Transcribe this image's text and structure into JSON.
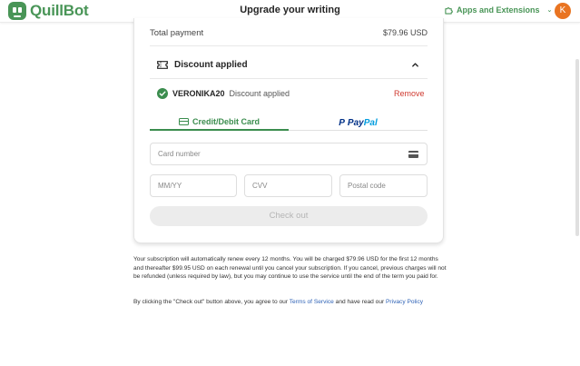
{
  "header": {
    "brand": "QuillBot",
    "title": "Upgrade your writing",
    "apps_label": "Apps and Extensions",
    "avatar_initial": "K"
  },
  "checkout": {
    "total_label": "Total payment",
    "total_value": "$79.96 USD",
    "discount_title": "Discount applied",
    "coupon_code": "VERONIKA20",
    "coupon_status": "Discount applied",
    "remove_label": "Remove",
    "tabs": {
      "card": "Credit/Debit Card",
      "paypal_a": "Pay",
      "paypal_b": "Pal"
    },
    "fields": {
      "card_placeholder": "Card number",
      "expiry_placeholder": "MM/YY",
      "cvv_placeholder": "CVV",
      "postal_placeholder": "Postal code"
    },
    "button_label": "Check out"
  },
  "legal": {
    "renewal": "Your subscription will automatically renew every 12 months. You will be charged $79.96 USD for the first 12 months and thereafter $99.95 USD on each renewal until you cancel your subscription. If you cancel, previous charges will not be refunded (unless required by law), but you may continue to use the service until the end of the term you paid for.",
    "consent_prefix": "By clicking the \"Check out\" button above, you agree to our ",
    "terms_link": "Terms of Service",
    "consent_mid": " and have read our ",
    "privacy_link": "Privacy Policy"
  },
  "colors": {
    "brand_green": "#499557",
    "accent_green": "#3b8d4e",
    "remove_red": "#cf3a30",
    "avatar_orange": "#e97421",
    "link_blue": "#2e62b6"
  },
  "icons": [
    "quillbot-logo-icon",
    "puzzle-icon",
    "chevron-down-icon",
    "ticket-icon",
    "chevron-up-icon",
    "check-circle-icon",
    "credit-card-icon",
    "paypal-logo-icon",
    "card-brand-icon"
  ]
}
